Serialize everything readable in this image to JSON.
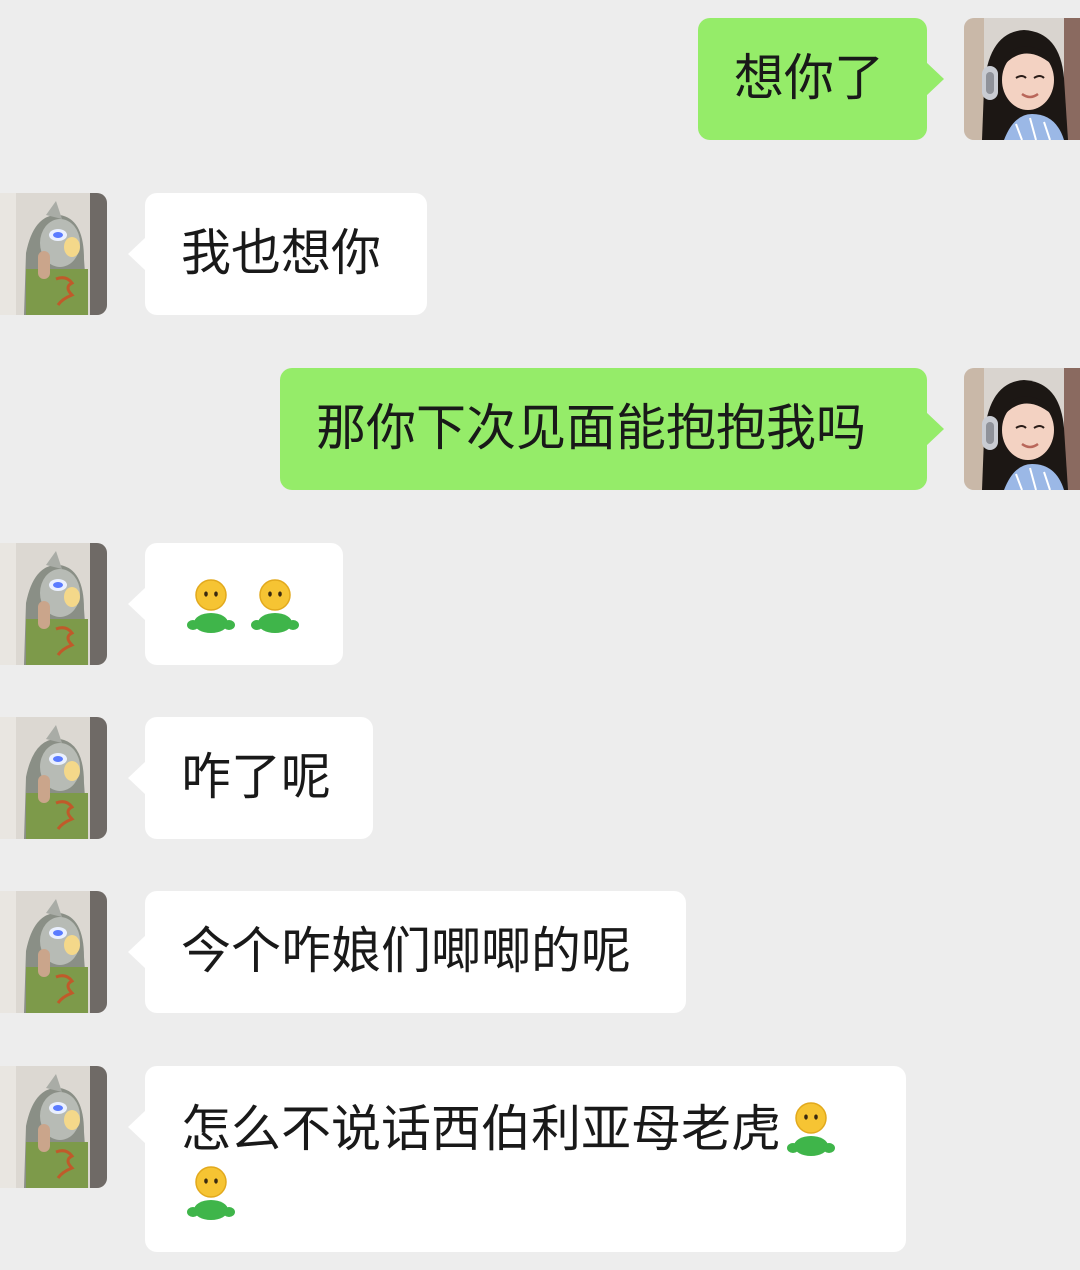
{
  "conversation": {
    "messages": [
      {
        "sender": "me",
        "text": "想你了"
      },
      {
        "sender": "other",
        "text": "我也想你"
      },
      {
        "sender": "me",
        "text": "那你下次见面能抱抱我吗"
      },
      {
        "sender": "other",
        "text": "",
        "emojis": [
          "person-emoji",
          "person-emoji"
        ]
      },
      {
        "sender": "other",
        "text": "咋了呢"
      },
      {
        "sender": "other",
        "text": "今个咋娘们唧唧的呢"
      },
      {
        "sender": "other",
        "text": "怎么不说话西伯利亚母老虎",
        "emojis": [
          "person-emoji",
          "person-emoji"
        ]
      }
    ]
  },
  "colors": {
    "background": "#ededed",
    "my_bubble": "#95ec69",
    "their_bubble": "#ffffff",
    "text": "#191919"
  }
}
